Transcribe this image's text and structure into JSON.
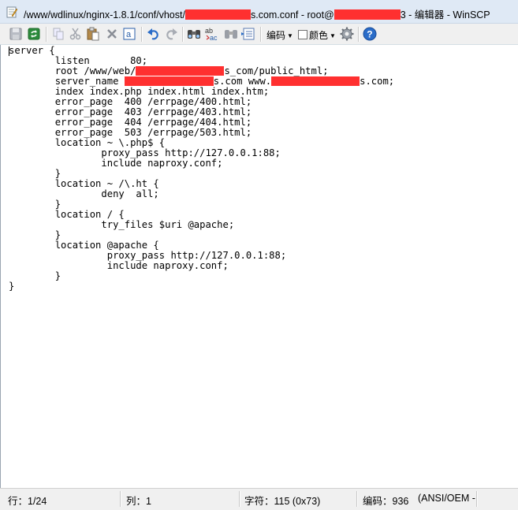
{
  "window": {
    "title_prefix": "/www/wdlinux/nginx-1.8.1/conf/vhost/",
    "title_mid": "s.com.conf - root@",
    "title_suffix": "3 - 编辑器 - WinSCP"
  },
  "toolbar": {
    "encoding_label": "编码",
    "color_label": "颜色"
  },
  "editor": {
    "lines": [
      {
        "pre": "server {",
        "redact": 0,
        "post": ""
      },
      {
        "pre": "        listen       80;",
        "redact": 0,
        "post": ""
      },
      {
        "pre": "        root /www/web/",
        "redact": 112,
        "post": "s_com/public_html;"
      },
      {
        "pre": "        server_name ",
        "redact": 113,
        "post": "s.com www.",
        "redact2": 112,
        "post2": "s.com;"
      },
      {
        "pre": "        index index.php index.html index.htm;",
        "redact": 0,
        "post": ""
      },
      {
        "pre": "        error_page  400 /errpage/400.html;",
        "redact": 0,
        "post": ""
      },
      {
        "pre": "        error_page  403 /errpage/403.html;",
        "redact": 0,
        "post": ""
      },
      {
        "pre": "        error_page  404 /errpage/404.html;",
        "redact": 0,
        "post": ""
      },
      {
        "pre": "        error_page  503 /errpage/503.html;",
        "redact": 0,
        "post": ""
      },
      {
        "pre": "        location ~ \\.php$ {",
        "redact": 0,
        "post": ""
      },
      {
        "pre": "                proxy_pass http://127.0.0.1:88;",
        "redact": 0,
        "post": ""
      },
      {
        "pre": "                include naproxy.conf;",
        "redact": 0,
        "post": ""
      },
      {
        "pre": "        }",
        "redact": 0,
        "post": ""
      },
      {
        "pre": "        location ~ /\\.ht {",
        "redact": 0,
        "post": ""
      },
      {
        "pre": "                deny  all;",
        "redact": 0,
        "post": ""
      },
      {
        "pre": "        }",
        "redact": 0,
        "post": ""
      },
      {
        "pre": "        location / {",
        "redact": 0,
        "post": ""
      },
      {
        "pre": "                try_files $uri @apache;",
        "redact": 0,
        "post": ""
      },
      {
        "pre": "        }",
        "redact": 0,
        "post": ""
      },
      {
        "pre": "        location @apache {",
        "redact": 0,
        "post": ""
      },
      {
        "pre": "                 proxy_pass http://127.0.0.1:88;",
        "redact": 0,
        "post": ""
      },
      {
        "pre": "                 include naproxy.conf;",
        "redact": 0,
        "post": ""
      },
      {
        "pre": "        }",
        "redact": 0,
        "post": ""
      },
      {
        "pre": "}",
        "redact": 0,
        "post": ""
      }
    ]
  },
  "status": {
    "line": "行：1/24",
    "column": "列：1",
    "char": "字符：115 (0x73)",
    "encoding": "编码：936",
    "charset": "(ANSI/OEM -"
  }
}
